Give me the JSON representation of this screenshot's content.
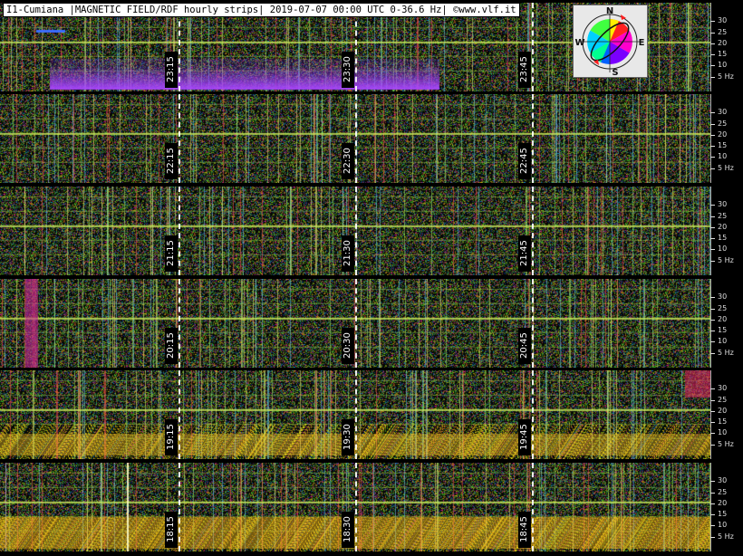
{
  "header": {
    "title": "I1-Cumiana |MAGNETIC FIELD/RDF hourly strips| 2019-07-07 00:00 UTC 0-36.6 Hz| ©www.vlf.it"
  },
  "compass": {
    "icon": "compass-rose-icon",
    "north": "N",
    "east": "E",
    "south": "S",
    "west": "W"
  },
  "frequency_scale": {
    "unit": "Hz",
    "labels": [
      "30",
      "25",
      "20",
      "15",
      "10",
      "5 Hz"
    ],
    "values_hz": [
      30,
      25,
      20,
      15,
      10,
      5
    ],
    "max_hz": 36.6
  },
  "strips": [
    {
      "hour": "23",
      "ticks": [
        "23:15",
        "23:30",
        "23:45"
      ]
    },
    {
      "hour": "22",
      "ticks": [
        "22:15",
        "22:30",
        "22:45"
      ]
    },
    {
      "hour": "21",
      "ticks": [
        "21:15",
        "21:30",
        "21:45"
      ]
    },
    {
      "hour": "20",
      "ticks": [
        "20:15",
        "20:30",
        "20:45"
      ]
    },
    {
      "hour": "19",
      "ticks": [
        "19:15",
        "19:30",
        "19:45"
      ]
    },
    {
      "hour": "18",
      "ticks": [
        "18:15",
        "18:30",
        "18:45"
      ]
    }
  ],
  "colors": {
    "background": "#000000",
    "schumann_line": "#c8e85a",
    "tick_line": "#ffffff",
    "title_bg": "#ffffff"
  }
}
